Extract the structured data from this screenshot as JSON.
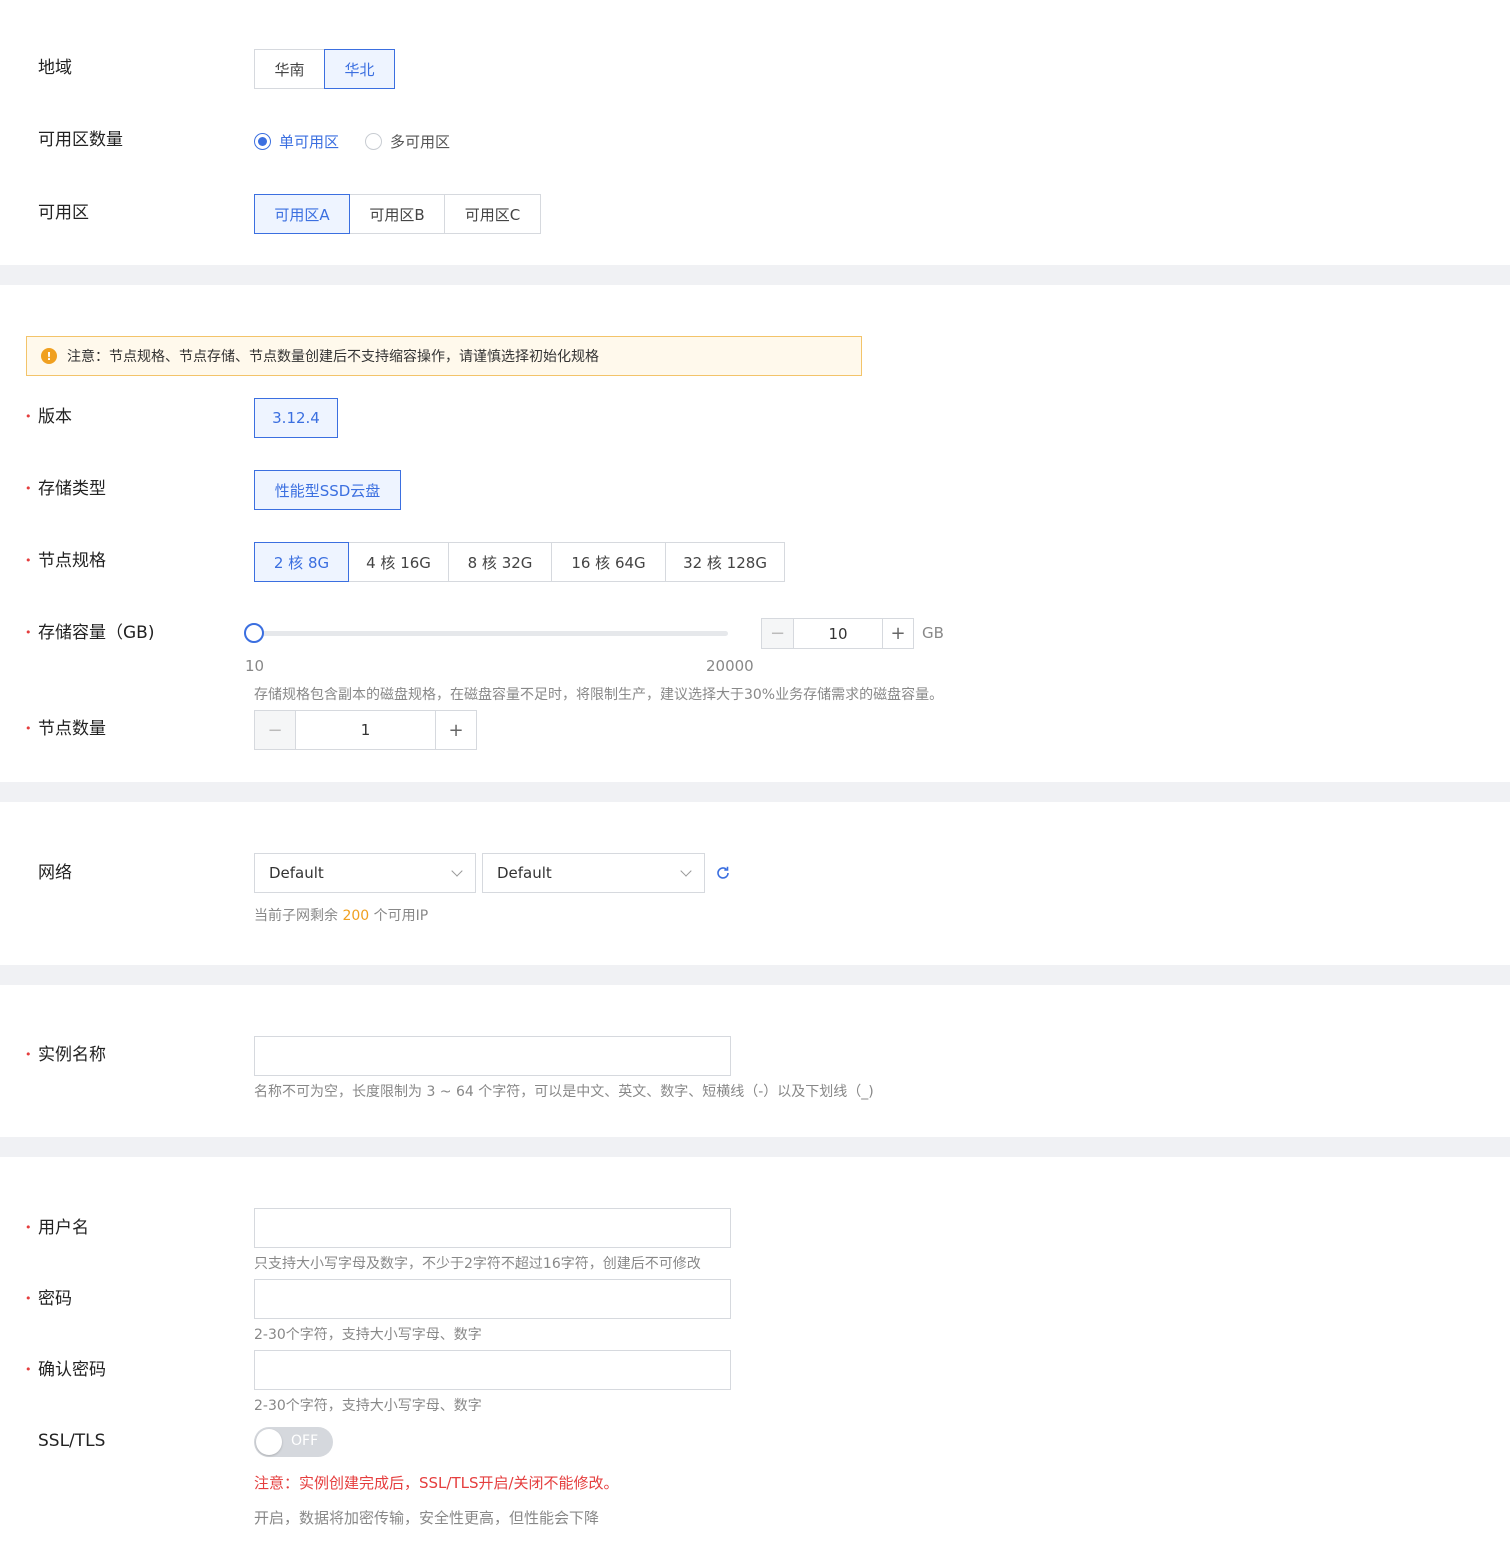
{
  "region": {
    "label": "地域",
    "options": [
      "华南",
      "华北"
    ],
    "selected": 1
  },
  "az_count": {
    "label": "可用区数量",
    "options": [
      "单可用区",
      "多可用区"
    ],
    "selected": 0
  },
  "az": {
    "label": "可用区",
    "options": [
      "可用区A",
      "可用区B",
      "可用区C"
    ],
    "selected": 0
  },
  "notice": {
    "text": "注意：节点规格、节点存储、节点数量创建后不支持缩容操作，请谨慎选择初始化规格"
  },
  "version": {
    "label": "版本",
    "options": [
      "3.12.4"
    ],
    "selected": 0
  },
  "storage_type": {
    "label": "存储类型",
    "options": [
      "性能型SSD云盘"
    ],
    "selected": 0
  },
  "node_spec": {
    "label": "节点规格",
    "options": [
      "2 核 8G",
      "4 核 16G",
      "8 核 32G",
      "16 核 64G",
      "32 核 128G"
    ],
    "selected": 0
  },
  "storage_capacity": {
    "label": "存储容量（GB)",
    "min_label": "10",
    "max_label": "20000",
    "min": 10,
    "max": 20000,
    "value": "10",
    "unit": "GB",
    "hint": "存储规格包含副本的磁盘规格，在磁盘容量不足时，将限制生产，建议选择大于30%业务存储需求的磁盘容量。"
  },
  "node_count": {
    "label": "节点数量",
    "value": "1"
  },
  "network": {
    "label": "网络",
    "vpc": "Default",
    "subnet": "Default",
    "hint_prefix": "当前子网剩余",
    "hint_count": "200",
    "hint_suffix": "个可用IP",
    "count_color": "#f0a020"
  },
  "instance_name": {
    "label": "实例名称",
    "value": "",
    "hint": "名称不可为空，长度限制为 3 ~ 64 个字符，可以是中文、英文、数字、短横线（-）以及下划线（_)"
  },
  "username": {
    "label": "用户名",
    "value": "",
    "hint": "只支持大小写字母及数字，不少于2字符不超过16字符，创建后不可修改"
  },
  "password": {
    "label": "密码",
    "value": "",
    "hint": "2-30个字符，支持大小写字母、数字"
  },
  "confirm_password": {
    "label": "确认密码",
    "value": "",
    "hint": "2-30个字符，支持大小写字母、数字"
  },
  "ssl": {
    "label": "SSL/TLS",
    "toggle_label": "OFF",
    "enabled": false,
    "warning": "注意：实例创建完成后，SSL/TLS开启/关闭不能修改。",
    "hint": "开启，数据将加密传输，安全性更高，但性能会下降"
  },
  "colors": {
    "accent": "#3b6fe0",
    "danger": "#e53e3e",
    "warning": "#f0a020",
    "band": "#f0f1f4"
  }
}
